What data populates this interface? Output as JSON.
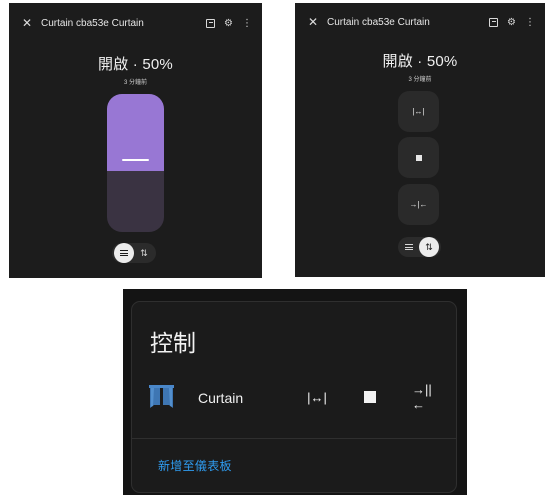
{
  "panel_a": {
    "header": {
      "close_glyph": "✕",
      "title": "Curtain cba53e Curtain",
      "icons": [
        "history-icon",
        "gear-icon",
        "more-vert-icon"
      ]
    },
    "state": {
      "status": "開啟 · 50%",
      "time": "3 分鐘前"
    },
    "slider": {
      "position_percent": 50,
      "fill_color": "#9877d4",
      "track_color": "#3a3342"
    },
    "mode_toggle": {
      "active": "slider"
    }
  },
  "panel_b": {
    "header": {
      "close_glyph": "✕",
      "title": "Curtain cba53e Curtain",
      "icons": [
        "history-icon",
        "gear-icon",
        "more-vert-icon"
      ]
    },
    "state": {
      "status": "開啟 · 50%",
      "time": "3 分鐘前"
    },
    "buttons": {
      "open_glyph": "|↔|",
      "close_glyph": "→|←"
    },
    "mode_toggle": {
      "active": "buttons"
    }
  },
  "panel_c": {
    "title": "控制",
    "entity": {
      "name": "Curtain",
      "icon": "curtain-icon",
      "icon_color": "#4a87c9"
    },
    "controls": {
      "open_glyph": "|↔|",
      "close_glyph": "→||←"
    },
    "add_to_dashboard": "新增至儀表板",
    "link_color": "#2f9cf0"
  }
}
